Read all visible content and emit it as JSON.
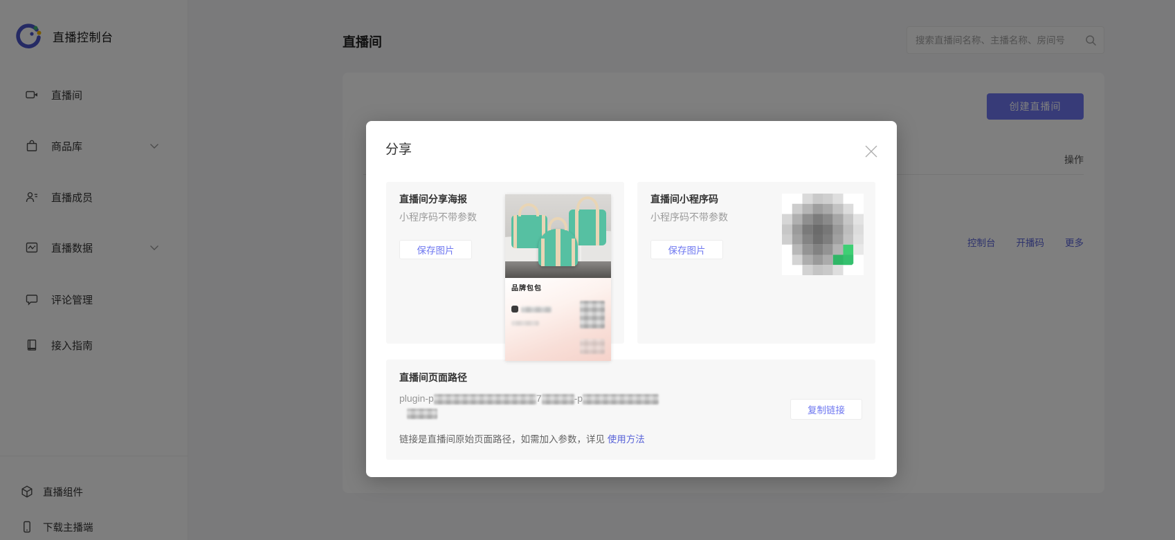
{
  "app": {
    "logo_title": "直播控制台"
  },
  "sidebar": {
    "items": [
      {
        "label": "直播间",
        "icon": "video-camera-icon",
        "has_chevron": false
      },
      {
        "label": "商品库",
        "icon": "shopping-bag-icon",
        "has_chevron": true
      },
      {
        "label": "直播成员",
        "icon": "members-icon",
        "has_chevron": false
      },
      {
        "label": "直播数据",
        "icon": "chart-icon",
        "has_chevron": true
      },
      {
        "label": "评论管理",
        "icon": "comment-icon",
        "has_chevron": false
      },
      {
        "label": "接入指南",
        "icon": "guide-icon",
        "has_chevron": false
      }
    ],
    "bottom_items": [
      {
        "label": "直播组件",
        "icon": "cube-icon"
      },
      {
        "label": "下载主播端",
        "icon": "phone-icon"
      }
    ]
  },
  "header": {
    "page_title": "直播间",
    "search_placeholder": "搜索直播间名称、主播名称、房间号"
  },
  "content": {
    "create_button": "创建直播间",
    "ops_header": "操作",
    "row_actions": [
      "控制台",
      "开播码",
      "更多"
    ]
  },
  "modal": {
    "title": "分享",
    "poster_section": {
      "title": "直播间分享海报",
      "subtitle": "小程序码不带参数",
      "button": "保存图片"
    },
    "qr_section": {
      "title": "直播间小程序码",
      "subtitle": "小程序码不带参数",
      "button": "保存图片"
    },
    "poster": {
      "caption": "品牌包包"
    },
    "path_section": {
      "title": "直播间页面路径",
      "path_prefix": "plugin-p",
      "path_visible_mid1": "7",
      "path_visible_mid2": "-p",
      "copy_button": "复制链接",
      "note_text": "链接是直播间原始页面路径，如需加入参数，详见 ",
      "note_link": "使用方法"
    }
  },
  "colors": {
    "accent": "#6e77f0",
    "link": "#5a64d8",
    "teal": "#56c0a2",
    "cream": "#e9d5b5",
    "qr_green": "#3ecf74"
  }
}
